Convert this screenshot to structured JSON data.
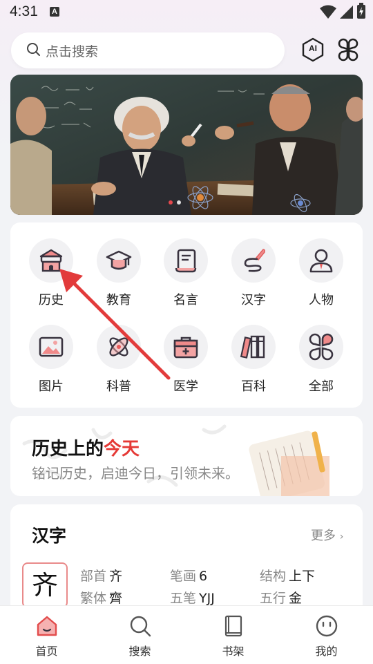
{
  "status": {
    "time": "4:31",
    "a_badge": "A"
  },
  "search": {
    "placeholder": "点击搜索",
    "ai_label": "AI"
  },
  "categories": [
    {
      "label": "历史"
    },
    {
      "label": "教育"
    },
    {
      "label": "名言"
    },
    {
      "label": "汉字"
    },
    {
      "label": "人物"
    },
    {
      "label": "图片"
    },
    {
      "label": "科普"
    },
    {
      "label": "医学"
    },
    {
      "label": "百科"
    },
    {
      "label": "全部"
    }
  ],
  "history": {
    "title_main": "历史上的",
    "title_red": "今天",
    "subtitle": "铭记历史，启迪今日，引领未来。"
  },
  "hanzi": {
    "title": "汉字",
    "more": "更多",
    "char": "齐",
    "fields": [
      {
        "k": "部首",
        "v": "齐"
      },
      {
        "k": "笔画",
        "v": "6"
      },
      {
        "k": "结构",
        "v": "上下"
      },
      {
        "k": "繁体",
        "v": "齊"
      },
      {
        "k": "五笔",
        "v": "YJJ"
      },
      {
        "k": "五行",
        "v": "金"
      }
    ]
  },
  "nav": [
    {
      "label": "首页"
    },
    {
      "label": "搜索"
    },
    {
      "label": "书架"
    },
    {
      "label": "我的"
    }
  ],
  "colors": {
    "accent": "#e53935",
    "icon_dark": "#3a3440"
  }
}
